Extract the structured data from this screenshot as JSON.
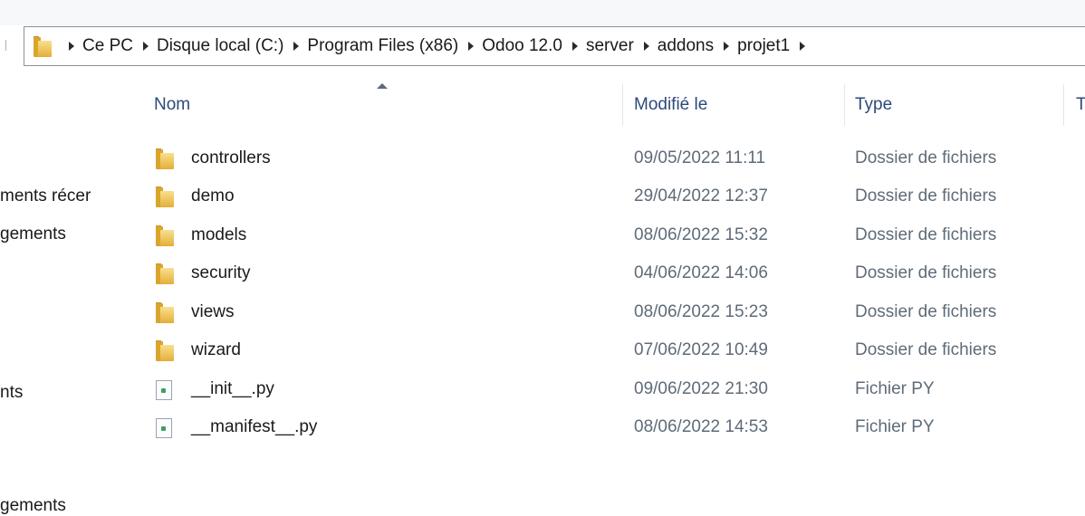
{
  "breadcrumb": [
    "Ce PC",
    "Disque local (C:)",
    "Program Files (x86)",
    "Odoo 12.0",
    "server",
    "addons",
    "projet1"
  ],
  "sidebar": {
    "items": [
      "ments récer",
      "gements",
      "nts",
      "gements"
    ]
  },
  "columns": {
    "name": "Nom",
    "modified": "Modifié le",
    "type": "Type",
    "size_cut": "T"
  },
  "files": [
    {
      "name": "controllers",
      "modified": "09/05/2022 11:11",
      "type": "Dossier de fichiers",
      "icon": "folder-icon"
    },
    {
      "name": "demo",
      "modified": "29/04/2022 12:37",
      "type": "Dossier de fichiers",
      "icon": "folder-icon"
    },
    {
      "name": "models",
      "modified": "08/06/2022 15:32",
      "type": "Dossier de fichiers",
      "icon": "folder-icon"
    },
    {
      "name": "security",
      "modified": "04/06/2022 14:06",
      "type": "Dossier de fichiers",
      "icon": "folder-icon"
    },
    {
      "name": "views",
      "modified": "08/06/2022 15:23",
      "type": "Dossier de fichiers",
      "icon": "folder-icon"
    },
    {
      "name": "wizard",
      "modified": "07/06/2022 10:49",
      "type": "Dossier de fichiers",
      "icon": "folder-icon"
    },
    {
      "name": "__init__.py",
      "modified": "09/06/2022 21:30",
      "type": "Fichier PY",
      "icon": "py-file-icon"
    },
    {
      "name": "__manifest__.py",
      "modified": "08/06/2022 14:53",
      "type": "Fichier PY",
      "icon": "py-file-icon"
    }
  ],
  "colors": {
    "header_text": "#2d4a7a",
    "meta_text": "#5f6b78",
    "folder": "#edc35a"
  }
}
